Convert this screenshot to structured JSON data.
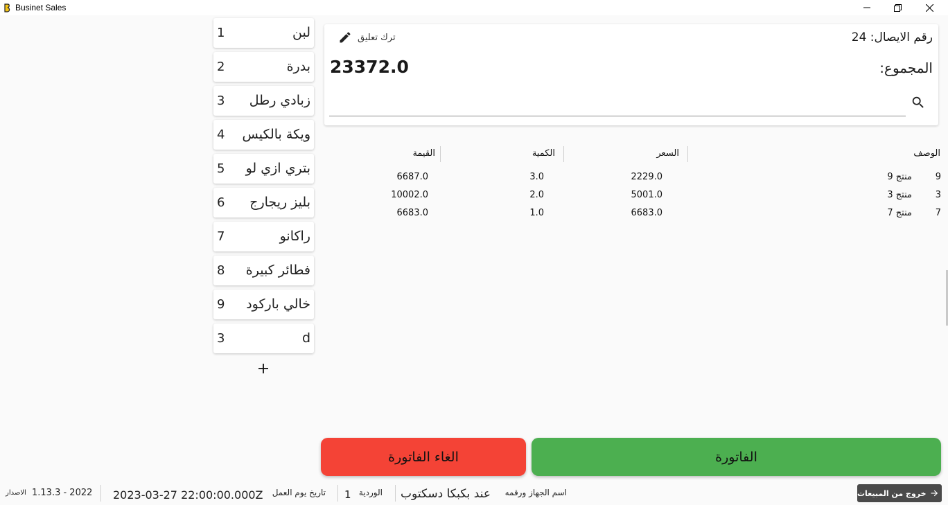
{
  "window": {
    "title": "Businet Sales",
    "icon": "app-logo-icon",
    "controls": [
      "minimize-icon",
      "maximize-icon",
      "close-icon"
    ]
  },
  "categories": [
    {
      "num": "1",
      "label": "لبن"
    },
    {
      "num": "2",
      "label": "بدرة"
    },
    {
      "num": "3",
      "label": "زبادي رطل"
    },
    {
      "num": "4",
      "label": "ويكة بالكيس"
    },
    {
      "num": "5",
      "label": "بتري ازي لو"
    },
    {
      "num": "6",
      "label": "بليز ريجارج"
    },
    {
      "num": "7",
      "label": "راكانو"
    },
    {
      "num": "8",
      "label": "فطائر كبيرة"
    },
    {
      "num": "9",
      "label": "خالي باركود"
    },
    {
      "num": "3",
      "label": "d"
    }
  ],
  "receipt": {
    "number_label": "رقم الايصال: 24",
    "comment_label": "ترك تعليق",
    "total_label": "المجموع:",
    "total_value": "23372.0",
    "search_placeholder": ""
  },
  "table": {
    "headers": {
      "desc": "الوصف",
      "price": "السعر",
      "qty": "الكمية",
      "value": "القيمة"
    },
    "rows": [
      {
        "id": "9",
        "name": "منتج 9",
        "price": "2229.0",
        "qty": "3.0",
        "value": "6687.0"
      },
      {
        "id": "3",
        "name": "منتج 3",
        "price": "5001.0",
        "qty": "2.0",
        "value": "10002.0"
      },
      {
        "id": "7",
        "name": "منتج 7",
        "price": "6683.0",
        "qty": "1.0",
        "value": "6683.0"
      }
    ]
  },
  "actions": {
    "cancel_label": "الغاء الفاتورة",
    "invoice_label": "الفاتورة"
  },
  "status": {
    "version_label": "الاصدار",
    "version_value": "1.13.3 - 2022",
    "workday_value": "2023-03-27 22:00:00.000Z",
    "workday_label": "تاريخ يوم العمل",
    "shift_value": "1",
    "shift_label": "الوردية",
    "device_value": "عند بكبكا دسكتوب",
    "device_label": "اسم الجهاز ورقمه",
    "exit_label": "خروج من المبيعات"
  },
  "colors": {
    "cancel": "#f44336",
    "invoice": "#4caf50",
    "exit": "#4a4a4a"
  }
}
